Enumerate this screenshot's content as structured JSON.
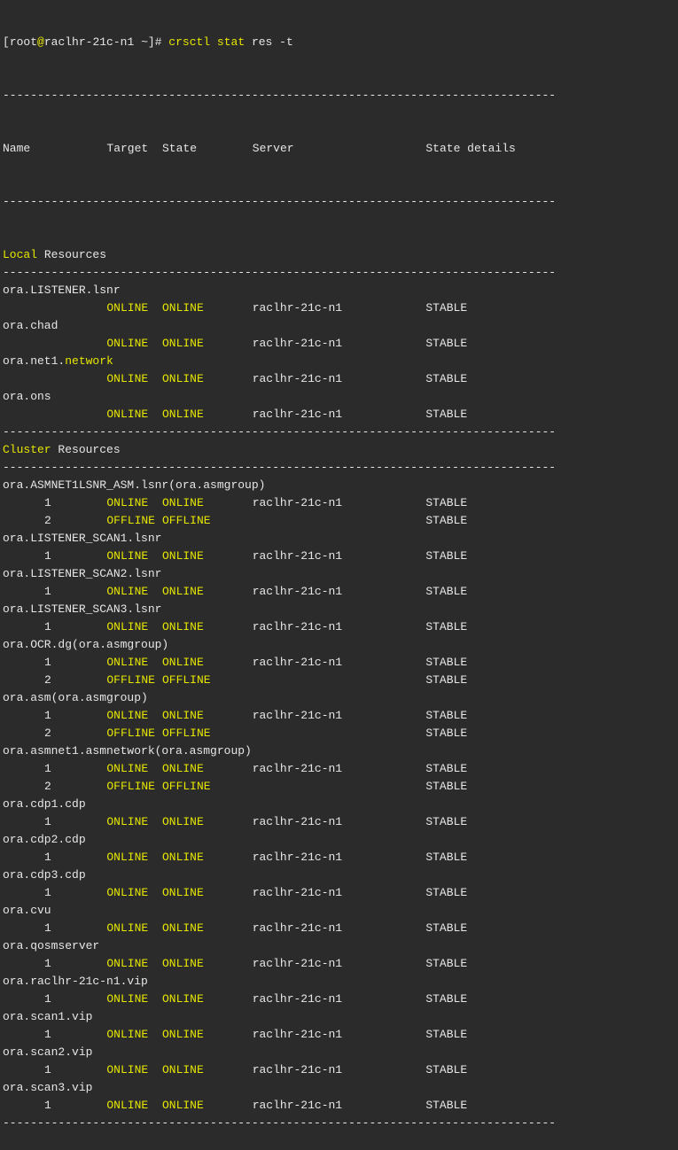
{
  "colors": {
    "background": "#2b2b2b",
    "text": "#e6e6e6",
    "highlight": "#e6e600"
  },
  "prompt": {
    "user": "root",
    "at": "@",
    "host": "raclhr-21c-n1",
    "cwd": "~",
    "command": "crsctl",
    "args1": "stat",
    "args2": "res -t"
  },
  "separator": "--------------------------------------------------------------------------------",
  "header": {
    "name": "Name",
    "target": "Target",
    "state": "State",
    "server": "Server",
    "details": "State details"
  },
  "sections": [
    {
      "title_hl": "Local",
      "title_rest": "Resources",
      "resources": [
        {
          "name": "ora.LISTENER.lsnr",
          "instances": [
            {
              "num": "",
              "target": "ONLINE",
              "state": "ONLINE",
              "server": "raclhr-21c-n1",
              "details": "STABLE"
            }
          ]
        },
        {
          "name": "ora.chad",
          "instances": [
            {
              "num": "",
              "target": "ONLINE",
              "state": "ONLINE",
              "server": "raclhr-21c-n1",
              "details": "STABLE"
            }
          ]
        },
        {
          "name": "ora.net1.",
          "name_hl": "network",
          "instances": [
            {
              "num": "",
              "target": "ONLINE",
              "state": "ONLINE",
              "server": "raclhr-21c-n1",
              "details": "STABLE"
            }
          ]
        },
        {
          "name": "ora.ons",
          "instances": [
            {
              "num": "",
              "target": "ONLINE",
              "state": "ONLINE",
              "server": "raclhr-21c-n1",
              "details": "STABLE"
            }
          ]
        }
      ]
    },
    {
      "title_hl": "Cluster",
      "title_rest": "Resources",
      "resources": [
        {
          "name": "ora.ASMNET1LSNR_ASM.lsnr(ora.asmgroup)",
          "instances": [
            {
              "num": "1",
              "target": "ONLINE",
              "state": "ONLINE",
              "server": "raclhr-21c-n1",
              "details": "STABLE"
            },
            {
              "num": "2",
              "target": "OFFLINE",
              "state": "OFFLINE",
              "server": "",
              "details": "STABLE"
            }
          ]
        },
        {
          "name": "ora.LISTENER_SCAN1.lsnr",
          "instances": [
            {
              "num": "1",
              "target": "ONLINE",
              "state": "ONLINE",
              "server": "raclhr-21c-n1",
              "details": "STABLE"
            }
          ]
        },
        {
          "name": "ora.LISTENER_SCAN2.lsnr",
          "instances": [
            {
              "num": "1",
              "target": "ONLINE",
              "state": "ONLINE",
              "server": "raclhr-21c-n1",
              "details": "STABLE"
            }
          ]
        },
        {
          "name": "ora.LISTENER_SCAN3.lsnr",
          "instances": [
            {
              "num": "1",
              "target": "ONLINE",
              "state": "ONLINE",
              "server": "raclhr-21c-n1",
              "details": "STABLE"
            }
          ]
        },
        {
          "name": "ora.OCR.dg(ora.asmgroup)",
          "instances": [
            {
              "num": "1",
              "target": "ONLINE",
              "state": "ONLINE",
              "server": "raclhr-21c-n1",
              "details": "STABLE"
            },
            {
              "num": "2",
              "target": "OFFLINE",
              "state": "OFFLINE",
              "server": "",
              "details": "STABLE"
            }
          ]
        },
        {
          "name": "ora.asm(ora.asmgroup)",
          "instances": [
            {
              "num": "1",
              "target": "ONLINE",
              "state": "ONLINE",
              "server": "raclhr-21c-n1",
              "details": "STABLE"
            },
            {
              "num": "2",
              "target": "OFFLINE",
              "state": "OFFLINE",
              "server": "",
              "details": "STABLE"
            }
          ]
        },
        {
          "name": "ora.asmnet1.asmnetwork(ora.asmgroup)",
          "instances": [
            {
              "num": "1",
              "target": "ONLINE",
              "state": "ONLINE",
              "server": "raclhr-21c-n1",
              "details": "STABLE"
            },
            {
              "num": "2",
              "target": "OFFLINE",
              "state": "OFFLINE",
              "server": "",
              "details": "STABLE"
            }
          ]
        },
        {
          "name": "ora.cdp1.cdp",
          "instances": [
            {
              "num": "1",
              "target": "ONLINE",
              "state": "ONLINE",
              "server": "raclhr-21c-n1",
              "details": "STABLE"
            }
          ]
        },
        {
          "name": "ora.cdp2.cdp",
          "instances": [
            {
              "num": "1",
              "target": "ONLINE",
              "state": "ONLINE",
              "server": "raclhr-21c-n1",
              "details": "STABLE"
            }
          ]
        },
        {
          "name": "ora.cdp3.cdp",
          "instances": [
            {
              "num": "1",
              "target": "ONLINE",
              "state": "ONLINE",
              "server": "raclhr-21c-n1",
              "details": "STABLE"
            }
          ]
        },
        {
          "name": "ora.cvu",
          "instances": [
            {
              "num": "1",
              "target": "ONLINE",
              "state": "ONLINE",
              "server": "raclhr-21c-n1",
              "details": "STABLE"
            }
          ]
        },
        {
          "name": "ora.qosmserver",
          "instances": [
            {
              "num": "1",
              "target": "ONLINE",
              "state": "ONLINE",
              "server": "raclhr-21c-n1",
              "details": "STABLE"
            }
          ]
        },
        {
          "name": "ora.raclhr-21c-n1.vip",
          "instances": [
            {
              "num": "1",
              "target": "ONLINE",
              "state": "ONLINE",
              "server": "raclhr-21c-n1",
              "details": "STABLE"
            }
          ]
        },
        {
          "name": "ora.scan1.vip",
          "instances": [
            {
              "num": "1",
              "target": "ONLINE",
              "state": "ONLINE",
              "server": "raclhr-21c-n1",
              "details": "STABLE"
            }
          ]
        },
        {
          "name": "ora.scan2.vip",
          "instances": [
            {
              "num": "1",
              "target": "ONLINE",
              "state": "ONLINE",
              "server": "raclhr-21c-n1",
              "details": "STABLE"
            }
          ]
        },
        {
          "name": "ora.scan3.vip",
          "instances": [
            {
              "num": "1",
              "target": "ONLINE",
              "state": "ONLINE",
              "server": "raclhr-21c-n1",
              "details": "STABLE"
            }
          ]
        }
      ]
    }
  ]
}
